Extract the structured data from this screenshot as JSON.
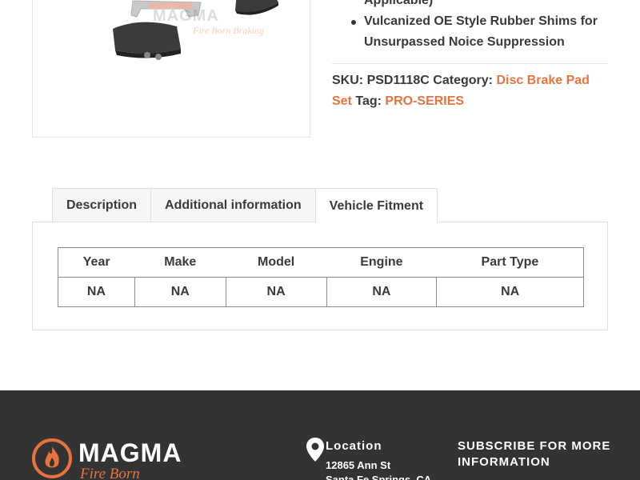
{
  "product": {
    "features": [
      "Applicable)",
      "Vulcanized OE Style Rubber Shims for Unsurpassed Noice Suppression"
    ],
    "sku_label": "SKU:",
    "sku": "PSD1118C",
    "category_label": "Category:",
    "category": "Disc Brake Pad Set",
    "tag_label": "Tag:",
    "tag": "PRO-SERIES",
    "image_watermark": "MAGMA",
    "image_watermark_sub": "Fire Born Braking"
  },
  "tabs": [
    {
      "label": "Description"
    },
    {
      "label": "Additional information"
    },
    {
      "label": "Vehicle Fitment",
      "active": true
    }
  ],
  "fitment": {
    "headers": [
      "Year",
      "Make",
      "Model",
      "Engine",
      "Part Type"
    ],
    "rows": [
      [
        "NA",
        "NA",
        "NA",
        "NA",
        "NA"
      ]
    ]
  },
  "footer": {
    "logo_text": "MAGMA",
    "logo_tagline": "Fire Born Braking",
    "location_title": "Location",
    "address_line1": "12865 Ann St",
    "address_line2": "Santa Fe Springs, CA",
    "subscribe_title": "SUBSCRIBE FOR MORE INFORMATION"
  },
  "colors": {
    "accent": "#e8733f",
    "footer_bg": "#333333",
    "text": "#3a3a3a"
  }
}
